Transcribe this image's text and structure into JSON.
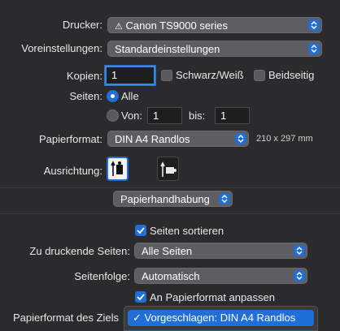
{
  "printer": {
    "label": "Drucker:",
    "value": "Canon TS9000 series",
    "warning_icon": "warning-icon"
  },
  "presets": {
    "label": "Voreinstellungen:",
    "value": "Standardeinstellungen"
  },
  "copies": {
    "label": "Kopien:",
    "value": "1",
    "bw_label": "Schwarz/Weiß",
    "duplex_label": "Beidseitig"
  },
  "pages": {
    "label": "Seiten:",
    "all_label": "Alle",
    "from_label": "Von:",
    "from_value": "1",
    "to_label": "bis:",
    "to_value": "1"
  },
  "paper": {
    "label": "Papierformat:",
    "value": "DIN A4 Randlos",
    "dimensions": "210 x 297 mm"
  },
  "orientation": {
    "label": "Ausrichtung:"
  },
  "section": {
    "value": "Papierhandhabung"
  },
  "collate": {
    "label": "Seiten sortieren",
    "checked": true
  },
  "pages_to_print": {
    "label": "Zu druckende Seiten:",
    "value": "Alle Seiten"
  },
  "page_order": {
    "label": "Seitenfolge:",
    "value": "Automatisch"
  },
  "scale_to_fit": {
    "label": "An Papierformat anpassen",
    "checked": true
  },
  "dest_paper": {
    "label": "Papierformat des Ziels",
    "menu_item": "Vorgeschlagen: DIN A4 Randlos",
    "checkmark": "✓"
  },
  "colors": {
    "accent": "#1f6fd6",
    "background": "#2b2b2d",
    "popup": "#5e5e62"
  }
}
